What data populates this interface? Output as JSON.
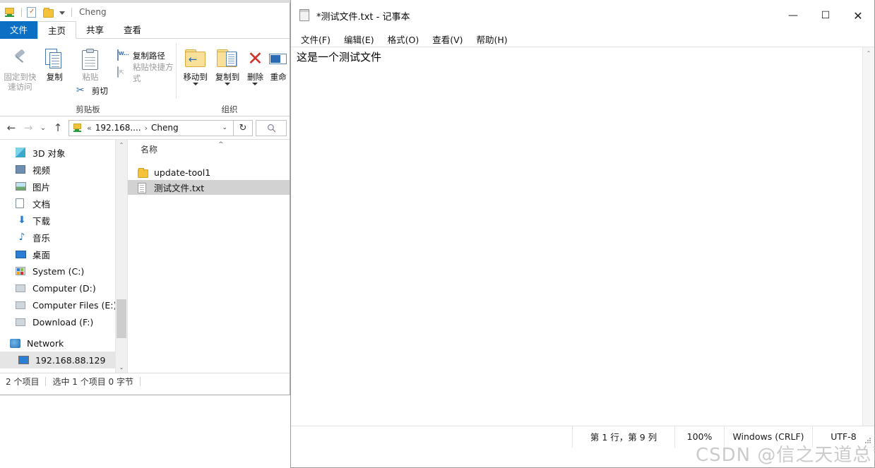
{
  "background_window": {
    "tab_labels": [
      "",
      ""
    ]
  },
  "explorer": {
    "quick_access": {
      "title": "Cheng",
      "icons": [
        "computer-icon",
        "properties-icon",
        "new-folder-icon",
        "customize-caret-icon"
      ]
    },
    "ribbon_tabs": [
      {
        "label": "文件",
        "kind": "file"
      },
      {
        "label": "主页",
        "kind": "active"
      },
      {
        "label": "共享",
        "kind": "normal"
      },
      {
        "label": "查看",
        "kind": "normal"
      }
    ],
    "ribbon": {
      "clipboard_group": {
        "label": "剪贴板",
        "pin_label": "固定到快\n速访问",
        "pin_line1": "固定到快",
        "pin_line2": "速访问",
        "copy_label": "复制",
        "paste_label": "粘贴",
        "cut_label": "剪切",
        "copy_path_label": "复制路径",
        "paste_shortcut_label": "粘贴快捷方式"
      },
      "organize_group": {
        "label": "组织",
        "move_to_label": "移动到",
        "copy_to_label": "复制到",
        "delete_label": "删除",
        "rename_label": "重命"
      }
    },
    "nav": {
      "back_icon": "back-arrow-icon",
      "forward_icon": "forward-arrow-icon",
      "recent_icon": "recent-locations-icon",
      "up_icon": "up-arrow-icon",
      "address_prefix": "«",
      "address_segments": [
        "192.168....",
        "Cheng"
      ],
      "address_chevron": "›",
      "dropdown_icon": "chevron-down-icon",
      "refresh_icon": "refresh-icon",
      "search_icon": "search-icon"
    },
    "tree": {
      "items": [
        {
          "label": "3D 对象",
          "icon": "3d-objects-icon",
          "level": 1,
          "selected": false
        },
        {
          "label": "视频",
          "icon": "videos-icon",
          "level": 1,
          "selected": false
        },
        {
          "label": "图片",
          "icon": "pictures-icon",
          "level": 1,
          "selected": false
        },
        {
          "label": "文档",
          "icon": "documents-icon",
          "level": 1,
          "selected": false
        },
        {
          "label": "下载",
          "icon": "downloads-icon",
          "level": 1,
          "selected": false
        },
        {
          "label": "音乐",
          "icon": "music-icon",
          "level": 1,
          "selected": false
        },
        {
          "label": "桌面",
          "icon": "desktop-icon",
          "level": 1,
          "selected": false
        },
        {
          "label": "System (C:)",
          "icon": "system-drive-icon",
          "level": 1,
          "selected": false
        },
        {
          "label": "Computer (D:)",
          "icon": "drive-icon",
          "level": 1,
          "selected": false
        },
        {
          "label": "Computer Files (E:)",
          "icon": "drive-icon",
          "level": 1,
          "selected": false
        },
        {
          "label": "Download (F:)",
          "icon": "drive-icon",
          "level": 1,
          "selected": false
        },
        {
          "label": "Network",
          "icon": "network-icon",
          "level": 0,
          "selected": false
        },
        {
          "label": "192.168.88.129",
          "icon": "network-computer-icon",
          "level": 1,
          "selected": true
        }
      ]
    },
    "file_list": {
      "column_header": "名称",
      "sort_indicator": "^",
      "rows": [
        {
          "name": "update-tool1",
          "icon": "folder-icon",
          "selected": false
        },
        {
          "name": "测试文件.txt",
          "icon": "text-file-icon",
          "selected": true
        }
      ]
    },
    "status_bar": {
      "item_count": "2 个项目",
      "selection": "选中 1 个项目  0 字节"
    }
  },
  "notepad": {
    "title": "*测试文件.txt - 记事本",
    "icon": "notepad-icon",
    "window_controls": {
      "minimize": "—",
      "maximize": "☐",
      "close": "✕"
    },
    "menus": [
      {
        "label": "文件(F)"
      },
      {
        "label": "编辑(E)"
      },
      {
        "label": "格式(O)"
      },
      {
        "label": "查看(V)"
      },
      {
        "label": "帮助(H)"
      }
    ],
    "document_text": "这是一个测试文件",
    "scrollbar": {
      "up_icon": "chevron-up-icon",
      "down_icon": "chevron-down-icon"
    },
    "status_bar": {
      "position": "第 1 行，第 9 列",
      "zoom": "100%",
      "line_ending": "Windows (CRLF)",
      "encoding": "UTF-8"
    }
  },
  "watermark": {
    "text": "CSDN @信之天道总司一切"
  },
  "colors": {
    "file_tab_blue": "#0b6fc3",
    "selection_gray": "#d2d2d2",
    "tree_selection_gray": "#e5e5e5",
    "folder_yellow": "#f4c33a",
    "delete_red": "#d0342c"
  }
}
